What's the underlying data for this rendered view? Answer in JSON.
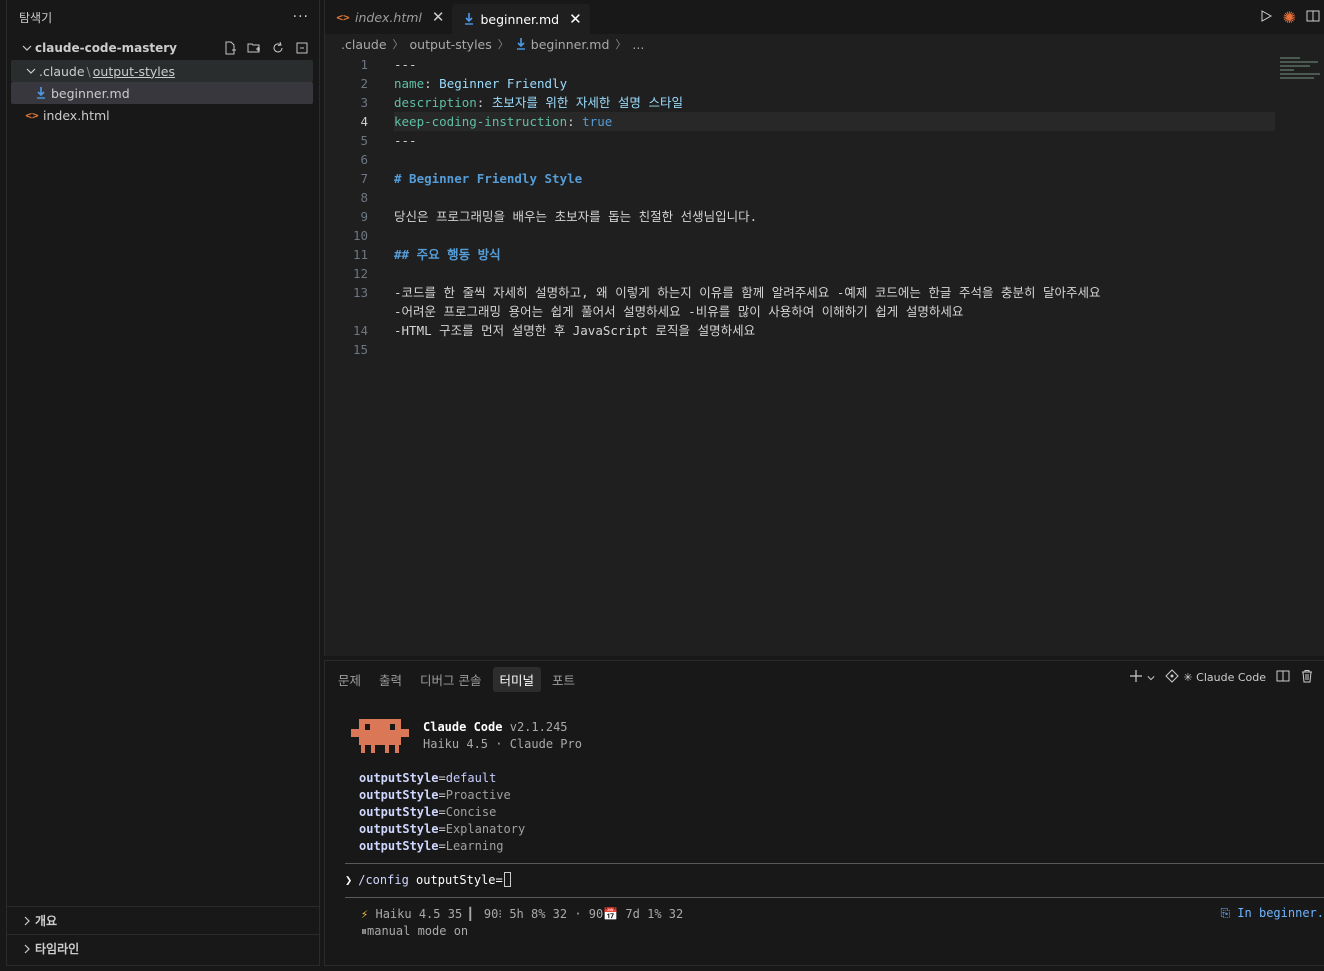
{
  "sidebar": {
    "title": "탐색기",
    "more_label": "···",
    "root_folder": "claude-code-mastery",
    "tree": {
      "folder_a": ".claude",
      "folder_sep": "\\",
      "folder_b": "output-styles",
      "file_md": "beginner.md",
      "file_html": "index.html"
    },
    "section_outline": "개요",
    "section_timeline": "타임라인"
  },
  "tabs": [
    {
      "label": "index.html",
      "active": false
    },
    {
      "label": "beginner.md",
      "active": true
    }
  ],
  "breadcrumb": [
    ".claude",
    "output-styles",
    "beginner.md",
    "..."
  ],
  "code": {
    "l1": "---",
    "l2_key": "name",
    "l2_val": "Beginner Friendly",
    "l3_key": "description",
    "l3_val": "초보자를 위한 자세한 설명 스타일",
    "l4_key": "keep-coding-instruction",
    "l4_val": "true",
    "l5": "---",
    "l7": "# Beginner Friendly Style",
    "l9": "당신은 프로그래밍을 배우는 초보자를 돕는 친절한 선생님입니다.",
    "l11": "## 주요 행동 방식",
    "l13a": "-코드를 한 줄씩 자세히 설명하고, 왜 이렇게 하는지 이유를 함께 알려주세요 -예제 코드에는 한글 주석을 충분히 달아주세요",
    "l13b": "-어려운 프로그래밍 용어는 쉽게 풀어서 설명하세요 -비유를 많이 사용하여 이해하기 쉽게 설명하세요",
    "l14": "-HTML 구조를 먼저 설명한 후 JavaScript 로직을 설명하세요",
    "line_numbers": [
      "1",
      "2",
      "3",
      "4",
      "5",
      "6",
      "7",
      "8",
      "9",
      "10",
      "11",
      "12",
      "13",
      "",
      "14",
      "15"
    ]
  },
  "panel": {
    "tabs": [
      "문제",
      "출력",
      "디버그 콘솔",
      "터미널",
      "포트"
    ],
    "active_tab": "터미널",
    "terminal_label": "✳ Claude Code"
  },
  "terminal": {
    "app_name": "Claude Code",
    "version": "v2.1.245",
    "model_line": "Haiku 4.5 · Claude Pro",
    "style_key": "outputStyle",
    "styles": [
      "default",
      "Proactive",
      "Concise",
      "Explanatory",
      "Learning"
    ],
    "prompt_cmd": "/config",
    "prompt_arg": "outputStyle=",
    "status_line1": "Haiku 4.5 35 ▎  90⁝ 5h 8% 32 ·  90",
    "status_line1_tail": " 7d 1% 32",
    "status_line2": "⏸manual mode on",
    "status_right": "In beginner."
  },
  "colors": {
    "accent_md": "#4d9be8",
    "accent_html": "#e37933",
    "claude_orange": "#d97757"
  }
}
